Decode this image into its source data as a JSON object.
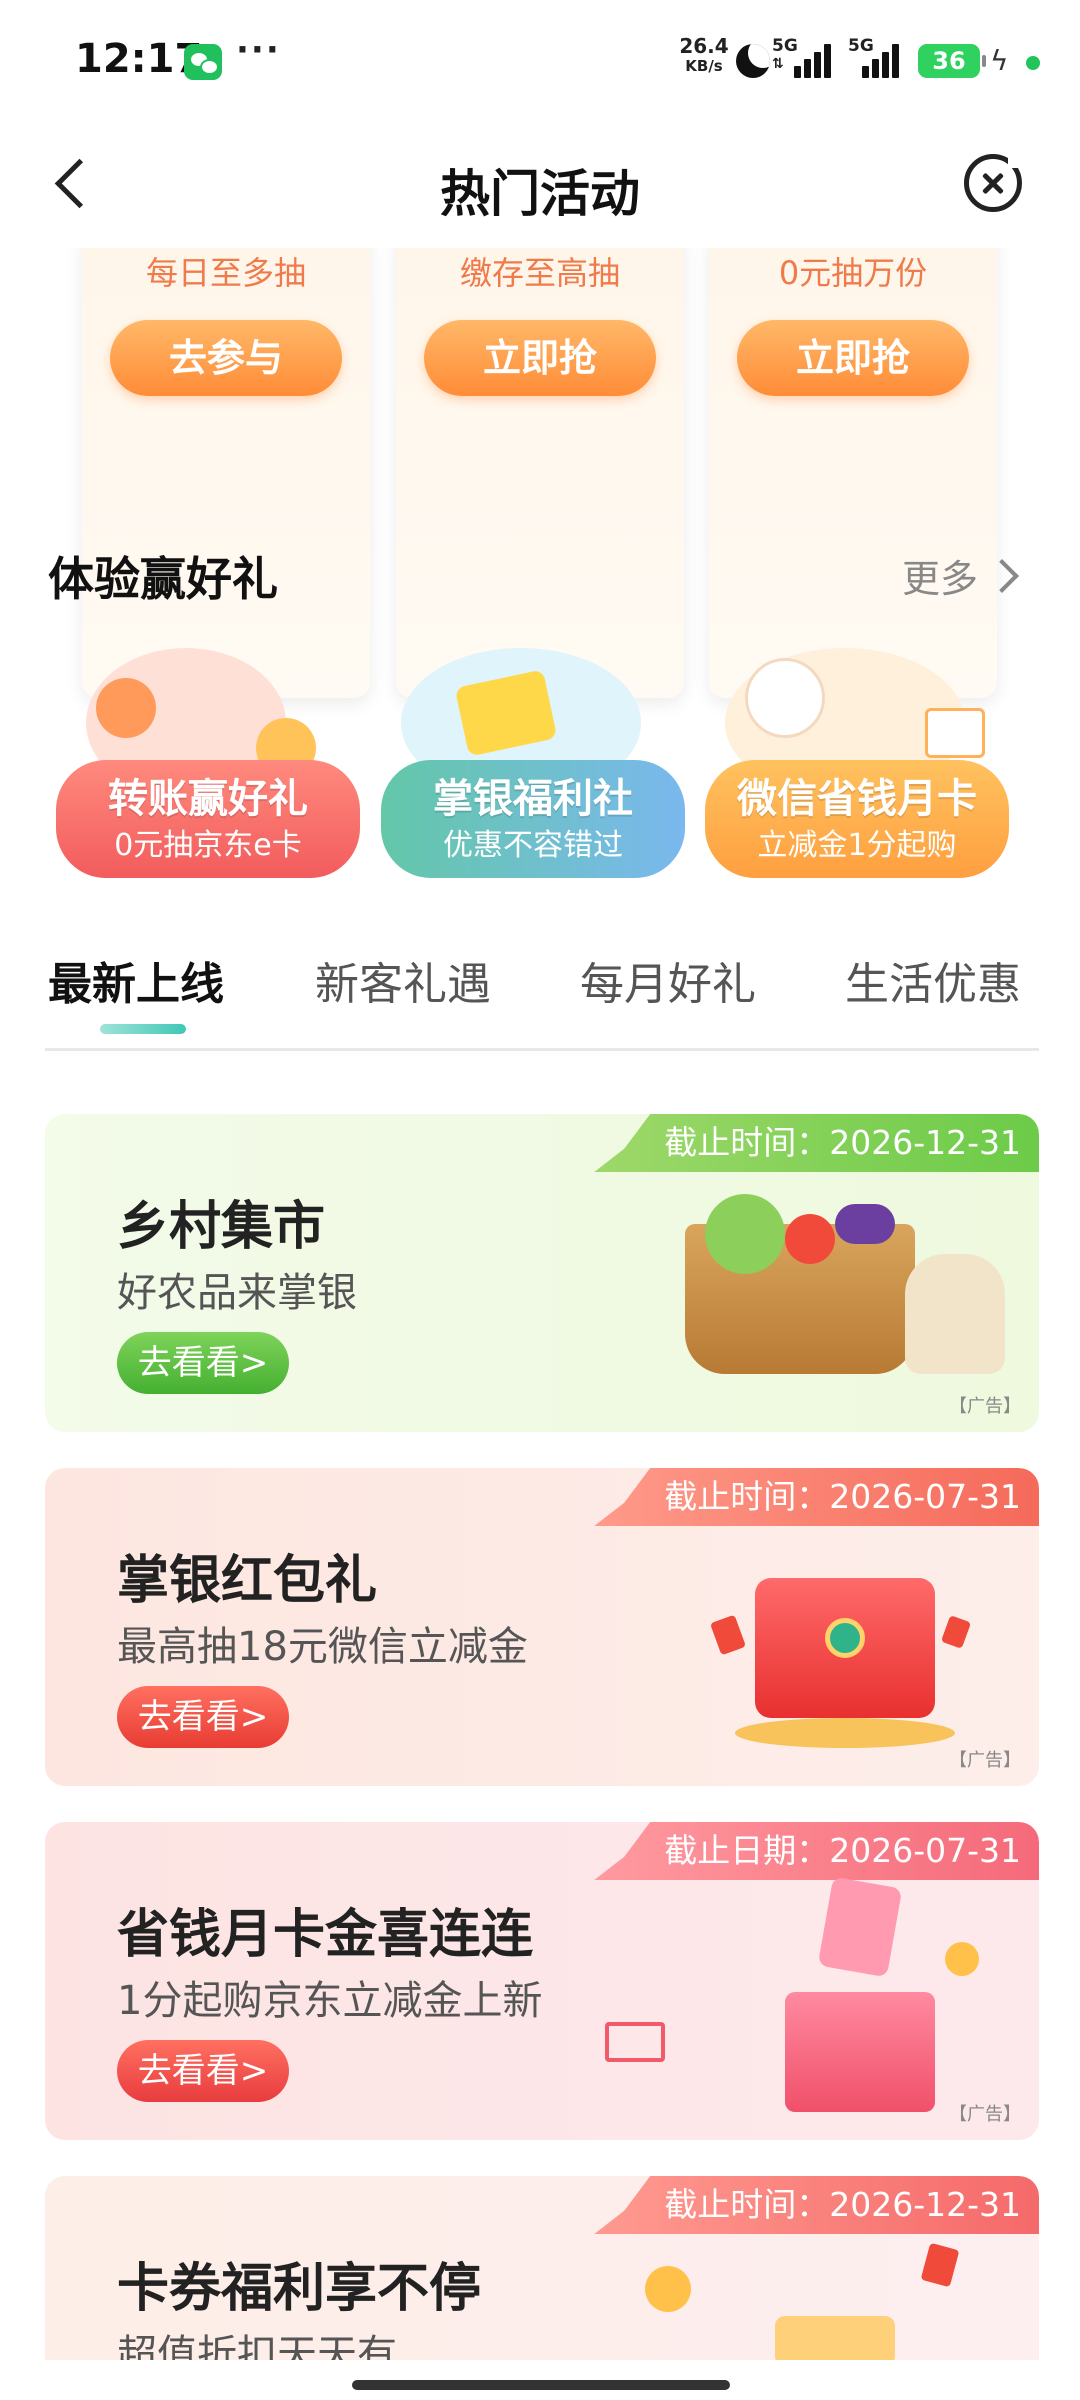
{
  "status_bar": {
    "time": "12:17",
    "more": "···",
    "speed_value": "26.4",
    "speed_unit": "KB/s",
    "network_1": "5G",
    "network_2": "5G",
    "battery": "36",
    "icons": [
      "wechat-icon",
      "moon-icon",
      "signal-icon",
      "battery-icon",
      "charging-icon"
    ]
  },
  "nav": {
    "title": "热门活动",
    "back_icon": "chevron-left-icon",
    "close_icon": "close-circle-icon"
  },
  "promo_cards": [
    {
      "desc": "每日至多抽",
      "button": "去参与"
    },
    {
      "desc": "缴存至高抽",
      "button": "立即抢"
    },
    {
      "desc": "0元抽万份",
      "button": "立即抢"
    }
  ],
  "experience": {
    "title": "体验赢好礼",
    "more": "更多",
    "cards": [
      {
        "title": "转账赢好礼",
        "subtitle": "0元抽京东e卡",
        "color": "#f46a6a"
      },
      {
        "title": "掌银福利社",
        "subtitle": "优惠不容错过",
        "color": "#6fc7e0"
      },
      {
        "title": "微信省钱月卡",
        "subtitle": "立减金1分起购",
        "color": "#ffb85a"
      }
    ]
  },
  "tabs": [
    {
      "label": "最新上线",
      "active": true
    },
    {
      "label": "新客礼遇",
      "active": false
    },
    {
      "label": "每月好礼",
      "active": false
    },
    {
      "label": "生活优惠",
      "active": false
    }
  ],
  "banners": [
    {
      "deadline": "截止时间：2026-12-31",
      "title": "乡村集市",
      "subtitle": "好农品来掌银",
      "button": "去看看>",
      "ad": "【广告】",
      "theme": "green"
    },
    {
      "deadline": "截止时间：2026-07-31",
      "title": "掌银红包礼",
      "subtitle": "最高抽18元微信立减金",
      "button": "去看看>",
      "ad": "【广告】",
      "theme": "red"
    },
    {
      "deadline": "截止日期：2026-07-31",
      "title": "省钱月卡金喜连连",
      "subtitle": "1分起购京东立减金上新",
      "button": "去看看>",
      "ad": "【广告】",
      "theme": "pink"
    },
    {
      "deadline": "截止时间：2026-12-31",
      "title": "卡券福利享不停",
      "subtitle": "超值折扣天天有",
      "theme": "pink"
    }
  ],
  "colors": {
    "accent_teal": "#3fc7b7",
    "orange": "#ff8c38",
    "green": "#5cc24a",
    "red": "#f0534a"
  }
}
